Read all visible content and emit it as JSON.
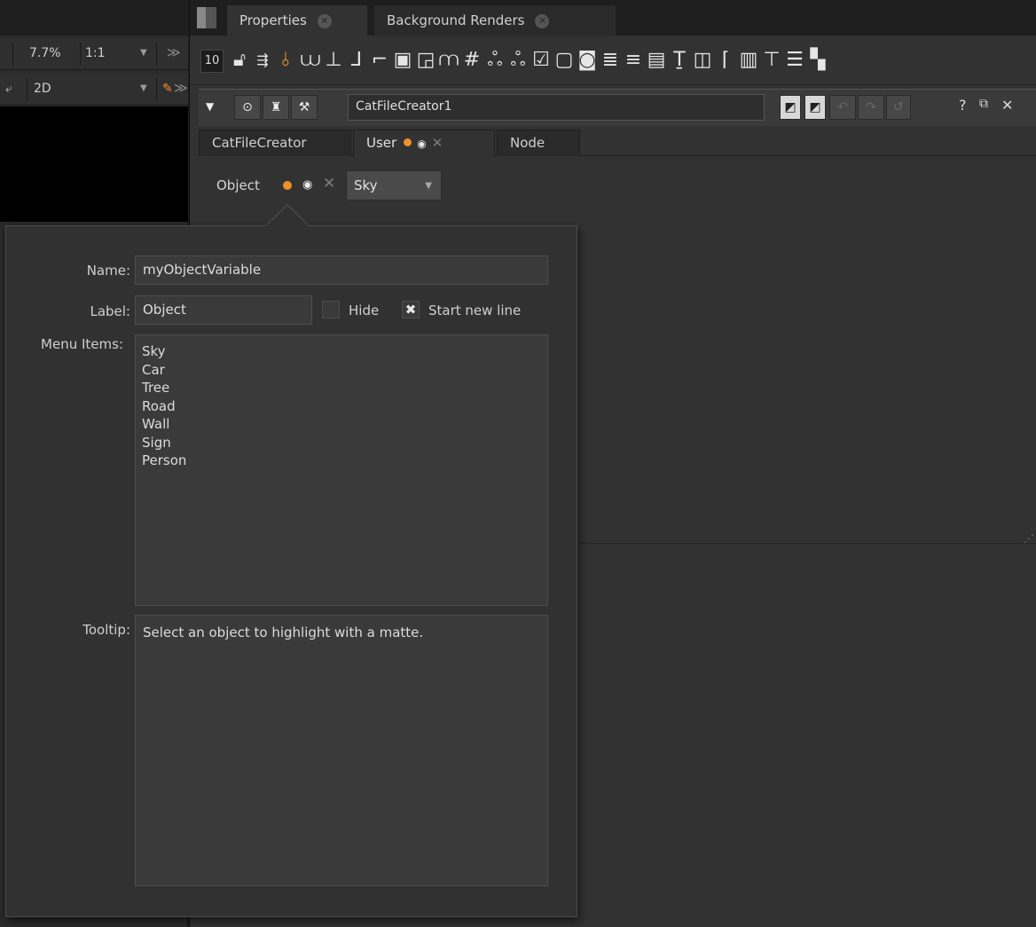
{
  "viewer": {
    "zoom": "7.7%",
    "ratio": "1:1",
    "view_mode": "2D"
  },
  "tabs": [
    {
      "label": "Properties"
    },
    {
      "label": "Background Renders"
    }
  ],
  "toolbar": {
    "max_panels": "10",
    "icons": [
      "lock-icon",
      "clear-icon",
      "pin-icon",
      "int-knob-icon",
      "xy-knob-icon",
      "xyz-knob-icon",
      "wh-knob-icon",
      "bbox-knob-icon",
      "size-knob-icon",
      "uv-knob-icon",
      "hash-icon",
      "color-icon",
      "color-alpha-icon",
      "checkbox-knob-icon",
      "button-knob-icon",
      "python-button-icon",
      "menu-knob-icon",
      "pulldown-icon",
      "text-input-icon",
      "text-knob-icon",
      "file-knob-icon",
      "tab-knob-icon",
      "group-knob-icon",
      "divider-label-icon",
      "divider-icon",
      "link-knob-icon"
    ]
  },
  "node": {
    "name": "CatFileCreator1"
  },
  "knob_tabs": [
    {
      "label": "CatFileCreator"
    },
    {
      "label": "User"
    },
    {
      "label": "Node"
    }
  ],
  "object_knob": {
    "label": "Object",
    "value": "Sky"
  },
  "editor": {
    "name_label": "Name:",
    "name_value": "myObjectVariable",
    "label_label": "Label:",
    "label_value": "Object",
    "hide_label": "Hide",
    "hide_checked": false,
    "start_new_line_label": "Start new line",
    "start_new_line_checked": true,
    "menu_items_label": "Menu Items:",
    "menu_items": [
      "Sky",
      "Car",
      "Tree",
      "Road",
      "Wall",
      "Sign",
      "Person"
    ],
    "tooltip_label": "Tooltip:",
    "tooltip_value": "Select an object to highlight with a matte."
  },
  "colors": {
    "accent_orange": "#f0902a",
    "panel_bg": "#323232",
    "field_bg": "#3a3a3a"
  }
}
